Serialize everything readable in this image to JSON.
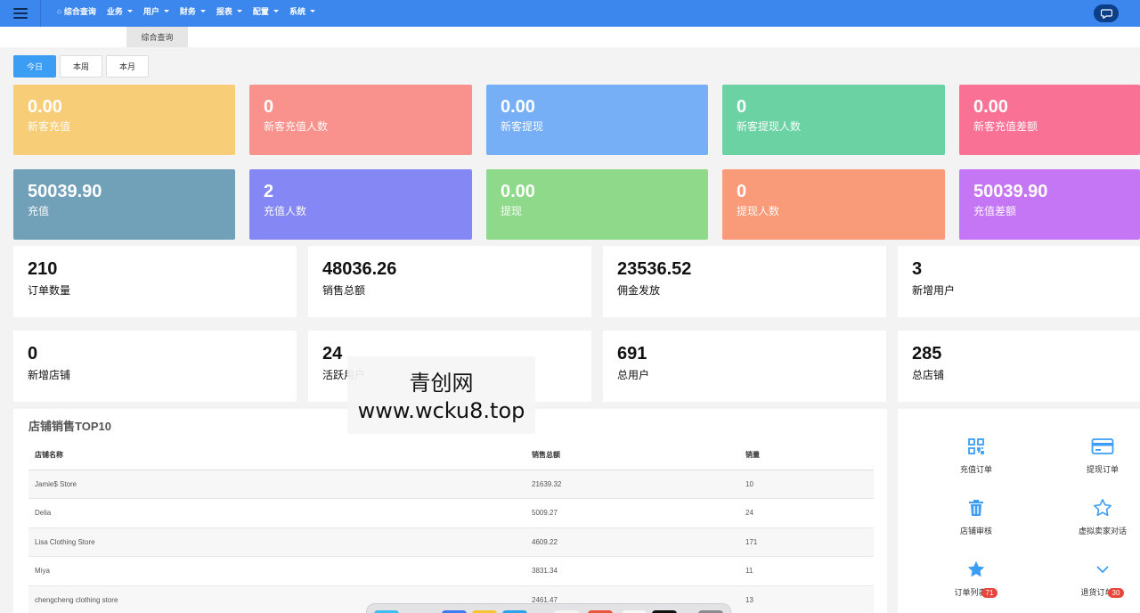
{
  "nav": {
    "home": "综合查询",
    "menus": [
      "业务",
      "用户",
      "财务",
      "报表",
      "配置",
      "系统"
    ]
  },
  "tab": {
    "label": "综合查询"
  },
  "periods": [
    "今日",
    "本周",
    "本月"
  ],
  "colored_cards": [
    {
      "value": "0.00",
      "label": "新客充值",
      "color": "#f8cd78"
    },
    {
      "value": "0",
      "label": "新客充值人数",
      "color": "#f9928d"
    },
    {
      "value": "0.00",
      "label": "新客提现",
      "color": "#76aff5"
    },
    {
      "value": "0",
      "label": "新客提现人数",
      "color": "#6bd2a3"
    },
    {
      "value": "0.00",
      "label": "新客充值差额",
      "color": "#f97296"
    },
    {
      "value": "50039.90",
      "label": "充值",
      "color": "#71a0b9"
    },
    {
      "value": "2",
      "label": "充值人数",
      "color": "#8588f4"
    },
    {
      "value": "0.00",
      "label": "提现",
      "color": "#8ed98a"
    },
    {
      "value": "0",
      "label": "提现人数",
      "color": "#f99a78"
    },
    {
      "value": "50039.90",
      "label": "充值差额",
      "color": "#c576f4"
    }
  ],
  "white_cards": [
    {
      "value": "210",
      "label": "订单数量"
    },
    {
      "value": "48036.26",
      "label": "销售总额"
    },
    {
      "value": "23536.52",
      "label": "佣金发放"
    },
    {
      "value": "3",
      "label": "新增用户"
    },
    {
      "value": "0",
      "label": "新增店铺"
    },
    {
      "value": "24",
      "label": "活跃用户"
    },
    {
      "value": "691",
      "label": "总用户"
    },
    {
      "value": "285",
      "label": "总店铺"
    }
  ],
  "top10": {
    "title": "店铺销售TOP10",
    "columns": [
      "店铺名称",
      "销售总额",
      "销量"
    ],
    "rows": [
      [
        "Jamie$ Store",
        "21639.32",
        "10"
      ],
      [
        "Delia",
        "5009.27",
        "24"
      ],
      [
        "Lisa Clothing Store",
        "4609.22",
        "171"
      ],
      [
        "Miya",
        "3831.34",
        "11"
      ],
      [
        "chengcheng clothing store",
        "2461.47",
        "13"
      ]
    ]
  },
  "shortcuts": [
    {
      "label": "充值订单",
      "icon": "qrcode-icon"
    },
    {
      "label": "提现订单",
      "icon": "credit-card-icon"
    },
    {
      "label": "店铺审核",
      "icon": "trash-icon"
    },
    {
      "label": "虚拟卖家对话",
      "icon": "star-outline-icon"
    },
    {
      "label": "订单列表",
      "icon": "star-icon",
      "badge": "71"
    },
    {
      "label": "退货订单",
      "icon": "chevron-down-icon",
      "badge": "30"
    }
  ],
  "watermark": {
    "line1": "青创网",
    "line2": "www.wcku8.top"
  },
  "colors": {
    "topbar": "#3c87ee",
    "accent": "#3c9df4",
    "shortcut_icon": "#3c9df4",
    "badge": "#e6473c"
  }
}
